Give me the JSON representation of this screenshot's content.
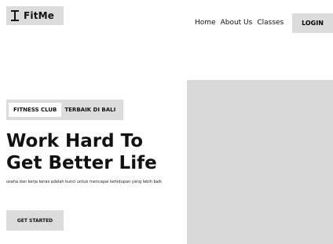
{
  "brand": {
    "name": "FitMe",
    "icon": "dumbbell-icon"
  },
  "nav": {
    "items": [
      "Home",
      "About Us",
      "Classes"
    ],
    "login_label": "LOGIN"
  },
  "hero": {
    "badge_highlight": "FITNESS CLUB",
    "badge_text": "TERBAIK DI BALI",
    "headline_line1": "Work Hard To",
    "headline_line2": "Get Better Life",
    "subtext": "usaha dan kerja keras adalah kunci untuk mencapai kehidupan yang lebih baik",
    "cta_label": "GET STARTED"
  },
  "colors": {
    "placeholder_gray": "#dcdcdc",
    "text": "#111111",
    "background": "#ffffff"
  }
}
